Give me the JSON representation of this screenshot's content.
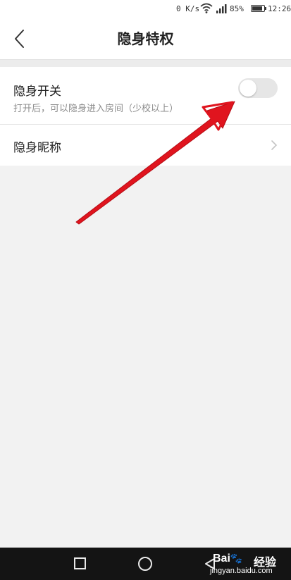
{
  "status_bar": {
    "net_speed": "0 K/s",
    "battery_percent": "85%",
    "time": "12:26",
    "icons": [
      "wifi-icon",
      "signal-icon",
      "battery-icon"
    ]
  },
  "nav": {
    "back_icon": "chevron-left-icon",
    "title": "隐身特权"
  },
  "settings": {
    "toggle_row": {
      "title": "隐身开关",
      "subtitle": "打开后，可以隐身进入房间（少校以上）",
      "enabled": false
    },
    "nickname_row": {
      "title": "隐身昵称",
      "chevron_icon": "chevron-right-icon"
    }
  },
  "annotation": {
    "icon": "red-arrow-icon",
    "color": "#e0141e"
  },
  "system_nav": {
    "icons": [
      "recent-apps-icon",
      "home-icon",
      "back-triangle-icon"
    ]
  },
  "watermark": {
    "logo_text": "Bai",
    "logo_text_2": "经验",
    "url": "jingyan.baidu.com"
  },
  "colors": {
    "background": "#f2f2f2",
    "surface": "#ffffff",
    "switch_off": "#e6e6e6",
    "subtitle_text": "#8c8c8c",
    "system_nav_bg": "#141414"
  }
}
